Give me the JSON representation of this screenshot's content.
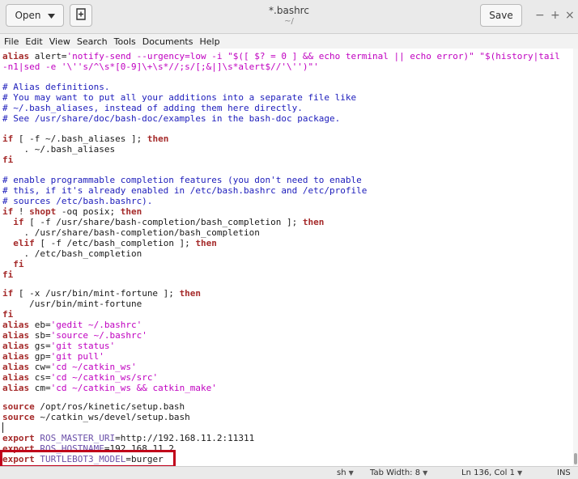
{
  "header": {
    "open_label": "Open",
    "open_dropdown_icon": "caret-down",
    "new_document_icon": "new-document",
    "title": "*.bashrc",
    "subtitle": "~/",
    "save_label": "Save",
    "minimize_glyph": "−",
    "maximize_glyph": "+",
    "close_glyph": "×"
  },
  "menu": {
    "items": [
      {
        "label": "File"
      },
      {
        "label": "Edit"
      },
      {
        "label": "View"
      },
      {
        "label": "Search"
      },
      {
        "label": "Tools"
      },
      {
        "label": "Documents"
      },
      {
        "label": "Help"
      }
    ]
  },
  "editor": {
    "l0_kw": "alias",
    "l0_a": " alert=",
    "l0_s": "'notify-send --urgency=low -i \"$([ $? = 0 ] && echo terminal || echo error)\" \"$(history|tail",
    "l1_s": "-n1|sed -e '\\''s/^\\s*[0-9]\\+\\s*//;s/[;&|]\\s*alert$//'\\'')\"'",
    "l2_c": "# Alias definitions.",
    "l3_c": "# You may want to put all your additions into a separate file like",
    "l4_c": "# ~/.bash_aliases, instead of adding them here directly.",
    "l5_c": "# See /usr/share/doc/bash-doc/examples in the bash-doc package.",
    "l6_kw1": "if",
    "l6_a": " [ -f ~/.bash_aliases ]; ",
    "l6_kw2": "then",
    "l7": "    . ~/.bash_aliases",
    "l8_kw": "fi",
    "l9_c": "# enable programmable completion features (you don't need to enable",
    "l10_c": "# this, if it's already enabled in /etc/bash.bashrc and /etc/profile",
    "l11_c": "# sources /etc/bash.bashrc).",
    "l12_kw1": "if",
    "l12_a": " ! ",
    "l12_kw2": "shopt",
    "l12_b": " -oq posix; ",
    "l12_kw3": "then",
    "l13_a": "  ",
    "l13_kw1": "if",
    "l13_b": " [ -f /usr/share/bash-completion/bash_completion ]; ",
    "l13_kw2": "then",
    "l14": "    . /usr/share/bash-completion/bash_completion",
    "l15_a": "  ",
    "l15_kw1": "elif",
    "l15_b": " [ -f /etc/bash_completion ]; ",
    "l15_kw2": "then",
    "l16": "    . /etc/bash_completion",
    "l17_a": "  ",
    "l17_kw": "fi",
    "l18_kw": "fi",
    "l19_kw1": "if",
    "l19_a": " [ -x /usr/bin/mint-fortune ]; ",
    "l19_kw2": "then",
    "l20": "     /usr/bin/mint-fortune",
    "l21_kw": "fi",
    "l22_kw": "alias",
    "l22_a": " eb=",
    "l22_s": "'gedit ~/.bashrc'",
    "l23_kw": "alias",
    "l23_a": " sb=",
    "l23_s": "'source ~/.bashrc'",
    "l24_kw": "alias",
    "l24_a": " gs=",
    "l24_s": "'git status'",
    "l25_kw": "alias",
    "l25_a": " gp=",
    "l25_s": "'git pull'",
    "l26_kw": "alias",
    "l26_a": " cw=",
    "l26_s": "'cd ~/catkin_ws'",
    "l27_kw": "alias",
    "l27_a": " cs=",
    "l27_s": "'cd ~/catkin_ws/src'",
    "l28_kw": "alias",
    "l28_a": " cm=",
    "l28_s": "'cd ~/catkin_ws && catkin_make'",
    "l29_kw": "source",
    "l29_a": " /opt/ros/kinetic/setup.bash",
    "l30_kw": "source",
    "l30_a": " ~/catkin_ws/devel/setup.bash",
    "l31_kw": "export",
    "l31_v": " ROS_MASTER_URI",
    "l31_a": "=http://192.168.11.2:11311",
    "l32_kw": "export",
    "l32_v": " ROS_HOSTNAME",
    "l32_a": "=192.168.11.2",
    "l33_kw": "export",
    "l33_v": " TURTLEBOT3_MODEL",
    "l33_a": "=burger"
  },
  "status": {
    "language": "sh",
    "tab_width": "Tab Width: 8",
    "position": "Ln 136, Col 1",
    "mode": "INS"
  }
}
